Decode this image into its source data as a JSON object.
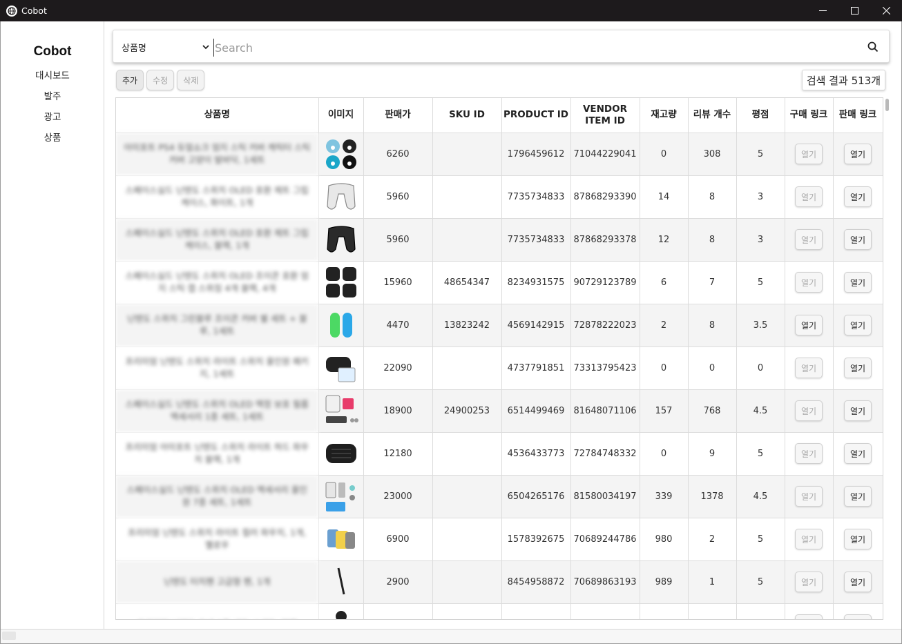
{
  "window": {
    "title": "Cobot"
  },
  "sidebar": {
    "brand": "Cobot",
    "items": [
      {
        "label": "대시보드"
      },
      {
        "label": "발주"
      },
      {
        "label": "광고"
      },
      {
        "label": "상품"
      }
    ]
  },
  "search": {
    "field_selected": "상품명",
    "placeholder": "Search",
    "value": ""
  },
  "toolbar": {
    "add_label": "추가",
    "edit_label": "수정",
    "delete_label": "삭제",
    "result_count": "검색 결과 513개"
  },
  "table": {
    "headers": {
      "name": "상품명",
      "image": "이미지",
      "price": "판매가",
      "sku": "SKU ID",
      "product": "PRODUCT ID",
      "vendor": "VENDOR ITEM ID",
      "stock": "재고량",
      "reviews": "리뷰 개수",
      "rating": "평점",
      "buy_link": "구매 링크",
      "sell_link": "판매 링크"
    },
    "open_label": "열기",
    "rows": [
      {
        "name": "아미포트 PS4 듀얼쇼크 엄지 스틱 커버 캐릭터 스틱커버 고양이 발바닥, 1세트",
        "image": "paw-caps",
        "price": "6260",
        "sku": "",
        "product": "1796459612",
        "vendor": "71044229041",
        "stock": "0",
        "reviews": "308",
        "rating": "5",
        "buy_enabled": false
      },
      {
        "name": "스페이스실드 닌텐도 스위치 OLED 호환 제트 그립 케이스, 화이트, 1개",
        "image": "grip-white",
        "price": "5960",
        "sku": "",
        "product": "7735734833",
        "vendor": "87868293390",
        "stock": "14",
        "reviews": "8",
        "rating": "3",
        "buy_enabled": false
      },
      {
        "name": "스페이스실드 닌텐도 스위치 OLED 호환 제트 그립 케이스, 블랙, 1개",
        "image": "grip-black",
        "price": "5960",
        "sku": "",
        "product": "7735734833",
        "vendor": "87868293378",
        "stock": "12",
        "reviews": "8",
        "rating": "3",
        "buy_enabled": false
      },
      {
        "name": "스페이스실드 닌텐도 스위치 OLED 조이콘 호환 엄지 스틱 캡 스위칭 4개 블랙, 4개",
        "image": "thumb-caps",
        "price": "15960",
        "sku": "48654347",
        "product": "8234931575",
        "vendor": "90729123789",
        "stock": "6",
        "reviews": "7",
        "rating": "5",
        "buy_enabled": false
      },
      {
        "name": "닌텐도 스위치 그린블루 조이콘 커버 쉘 세트 + 블루, 1세트",
        "image": "joycon",
        "price": "4470",
        "sku": "13823242",
        "product": "4569142915",
        "vendor": "72878222023",
        "stock": "2",
        "reviews": "8",
        "rating": "3.5",
        "buy_enabled": true
      },
      {
        "name": "프리미엄 닌텐도 스위치 라이트 스위치 올인원 패키지, 1세트",
        "image": "case-kit",
        "price": "22090",
        "sku": "",
        "product": "4737791851",
        "vendor": "73313795423",
        "stock": "0",
        "reviews": "0",
        "rating": "0",
        "buy_enabled": false
      },
      {
        "name": "스페이스실드 닌텐도 스위치 OLED 액정 보호 필름 액세서리 1종 세트, 1세트",
        "image": "oled-set",
        "price": "18900",
        "sku": "24900253",
        "product": "6514499469",
        "vendor": "81648071106",
        "stock": "157",
        "reviews": "768",
        "rating": "4.5",
        "buy_enabled": false
      },
      {
        "name": "프리미엄 아미포트 닌텐도 스위치 라이트 하드 파우치 블랙, 1개",
        "image": "pouch",
        "price": "12180",
        "sku": "",
        "product": "4536433773",
        "vendor": "72784748332",
        "stock": "0",
        "reviews": "9",
        "rating": "5",
        "buy_enabled": false
      },
      {
        "name": "스페이스실드 닌텐도 스위치 OLED 액세서리 올인원 7종 세트, 1세트",
        "image": "acc-set",
        "price": "23000",
        "sku": "",
        "product": "6504265176",
        "vendor": "81580034197",
        "stock": "339",
        "reviews": "1378",
        "rating": "4.5",
        "buy_enabled": false
      },
      {
        "name": "프리미엄 닌텐도 스위치 라이트 컬러 파우치, 1개, 옐로우",
        "image": "color-case",
        "price": "6900",
        "sku": "",
        "product": "1578392675",
        "vendor": "70689244786",
        "stock": "980",
        "reviews": "2",
        "rating": "5",
        "buy_enabled": false
      },
      {
        "name": "닌텐도 터치펜 고급형 펜, 1개",
        "image": "stylus",
        "price": "2900",
        "sku": "",
        "product": "8454958872",
        "vendor": "70689863193",
        "stock": "989",
        "reviews": "1",
        "rating": "5",
        "buy_enabled": false
      },
      {
        "name": "프리미엄 닌텐도 호넷 3종 세트, 1세트, 블랙",
        "image": "stick",
        "price": "",
        "sku": "",
        "product": "",
        "vendor": "",
        "stock": "",
        "reviews": "",
        "rating": "",
        "buy_enabled": false
      }
    ]
  }
}
